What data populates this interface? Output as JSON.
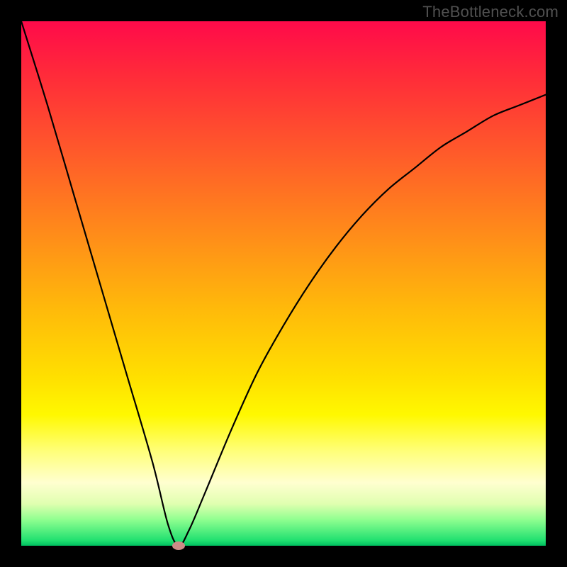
{
  "watermark": "TheBottleneck.com",
  "chart_data": {
    "type": "line",
    "title": "",
    "xlabel": "",
    "ylabel": "",
    "xlim": [
      0,
      100
    ],
    "ylim": [
      0,
      100
    ],
    "grid": false,
    "legend": false,
    "background_gradient": {
      "top": "#ff0a4a",
      "middle": "#ffe000",
      "bottom": "#00c060"
    },
    "series": [
      {
        "name": "bottleneck-curve",
        "x": [
          0,
          5,
          10,
          15,
          20,
          25,
          28,
          30,
          32,
          35,
          40,
          45,
          50,
          55,
          60,
          65,
          70,
          75,
          80,
          85,
          90,
          95,
          100
        ],
        "y": [
          100,
          84,
          67,
          50,
          33,
          16,
          4,
          0,
          3,
          10,
          22,
          33,
          42,
          50,
          57,
          63,
          68,
          72,
          76,
          79,
          82,
          84,
          86
        ]
      }
    ],
    "marker": {
      "x": 30,
      "y": 0,
      "color": "#cc8b87"
    }
  }
}
